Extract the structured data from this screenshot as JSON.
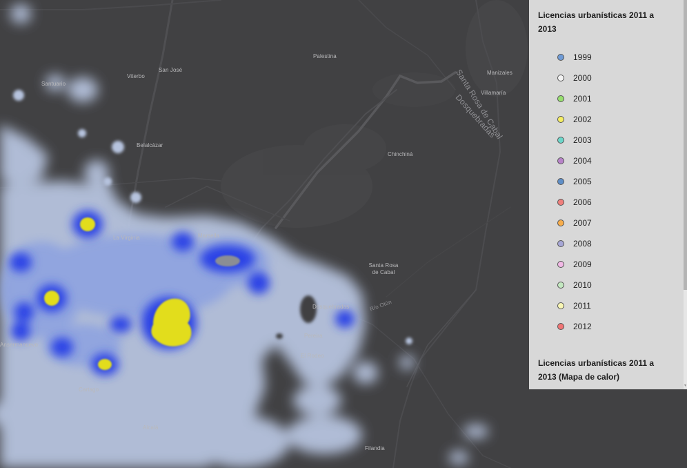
{
  "places": [
    {
      "name": "Palestina"
    },
    {
      "name": "Manizales"
    },
    {
      "name": "Villamaría"
    },
    {
      "name": "San José"
    },
    {
      "name": "Viterbo"
    },
    {
      "name": "Santuario"
    },
    {
      "name": "Belalcázar"
    },
    {
      "name": "Chinchiná"
    },
    {
      "name": "La Virginia"
    },
    {
      "name": "Marsella"
    },
    {
      "name": "Santa Rosa de Cabal"
    },
    {
      "name": "Dosquebradas"
    },
    {
      "name": "Pereira"
    },
    {
      "name": "El Rodeo"
    },
    {
      "name": "Cartago"
    },
    {
      "name": "Alcalá"
    },
    {
      "name": "Filandia"
    },
    {
      "name": "Ansermanuevo"
    },
    {
      "name": "Santa Rosa de Cabal"
    },
    {
      "name": "Dosquebradas"
    },
    {
      "name": "Río Otún"
    }
  ],
  "legend": {
    "title": "Licencias urbanísticas 2011 a 2013",
    "items": [
      {
        "label": "1999",
        "color": "#6f9bd6"
      },
      {
        "label": "2000",
        "color": "#f2f2f2"
      },
      {
        "label": "2001",
        "color": "#97df6f"
      },
      {
        "label": "2002",
        "color": "#f5ee62"
      },
      {
        "label": "2003",
        "color": "#6cd6c9"
      },
      {
        "label": "2004",
        "color": "#b883c9"
      },
      {
        "label": "2005",
        "color": "#5f8fc8"
      },
      {
        "label": "2006",
        "color": "#f07f7c"
      },
      {
        "label": "2007",
        "color": "#f7ad4c"
      },
      {
        "label": "2008",
        "color": "#a7a7d6"
      },
      {
        "label": "2009",
        "color": "#f2b9e6"
      },
      {
        "label": "2010",
        "color": "#c3e8c0"
      },
      {
        "label": "2011",
        "color": "#f8f6b4"
      },
      {
        "label": "2012",
        "color": "#f17575"
      }
    ],
    "heatmap_title": "Licencias urbanísticas 2011 a 2013 (Mapa de calor)"
  },
  "colors": {
    "basemap": "#414143",
    "heat_low": "#b9c7e0",
    "heat_mid": "#1f37e0",
    "heat_high": "#e2dd1a"
  }
}
